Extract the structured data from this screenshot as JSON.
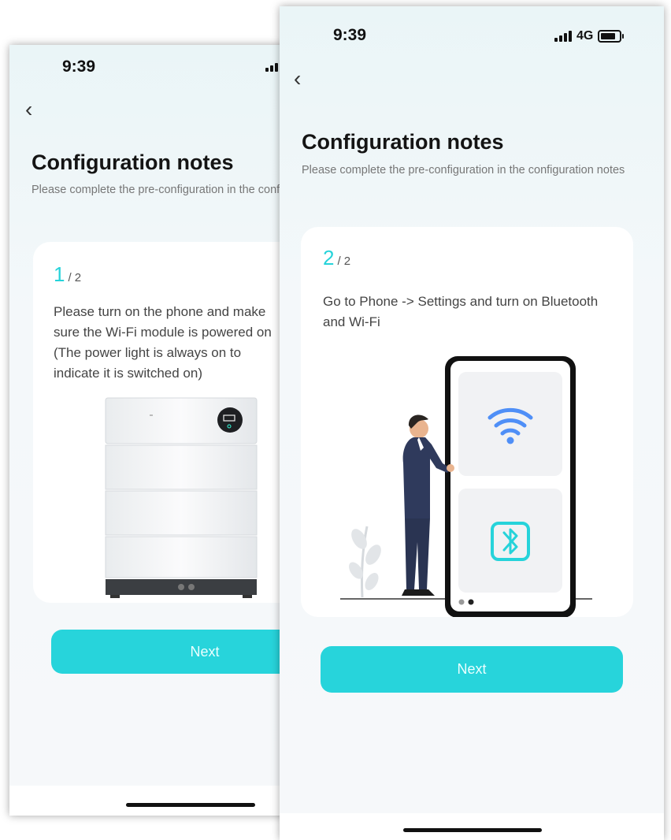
{
  "screen1": {
    "status_time": "9:39",
    "title": "Configuration notes",
    "subtitle": "Please complete the pre-configuration in the configuration notes",
    "step_current": "1",
    "step_total": "/ 2",
    "instruction": "Please turn on the phone and make sure the Wi-Fi module is powered on (The power light is always on to indicate it is switched on)",
    "next_label": "Next"
  },
  "screen2": {
    "status_time": "9:39",
    "network": "4G",
    "title": "Configuration notes",
    "subtitle": "Please complete the pre-configuration in the configuration notes",
    "step_current": "2",
    "step_total": "/ 2",
    "instruction": "Go to Phone -> Settings and turn on Bluetooth and Wi-Fi",
    "next_label": "Next"
  },
  "colors": {
    "accent": "#27d4db",
    "wifi_icon": "#4f8ff7",
    "bluetooth_icon": "#26d3da"
  },
  "icons": [
    "back-chevron-icon",
    "signal-icon",
    "battery-icon",
    "wifi-icon",
    "bluetooth-icon"
  ]
}
